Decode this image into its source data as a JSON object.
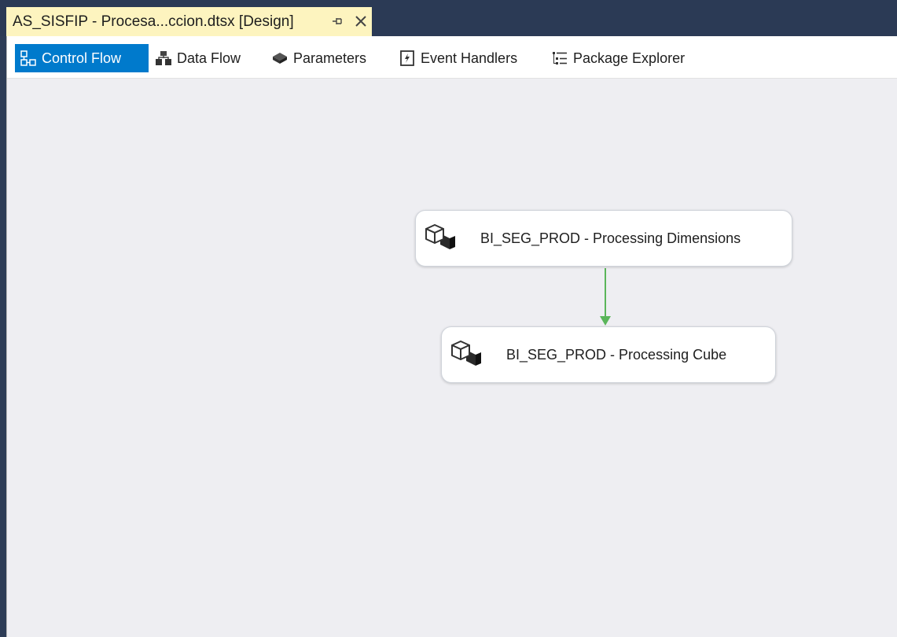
{
  "document_tab": {
    "title": "AS_SISFIP - Procesa...ccion.dtsx [Design]",
    "pin_icon": "pin-icon",
    "close_icon": "close-icon"
  },
  "designer_tabs": [
    {
      "label": "Control Flow",
      "icon": "control-flow-icon",
      "active": true
    },
    {
      "label": "Data Flow",
      "icon": "data-flow-icon",
      "active": false
    },
    {
      "label": "Parameters",
      "icon": "parameters-icon",
      "active": false
    },
    {
      "label": "Event Handlers",
      "icon": "event-handlers-icon",
      "active": false
    },
    {
      "label": "Package Explorer",
      "icon": "package-explorer-icon",
      "active": false
    }
  ],
  "tasks": [
    {
      "label": "BI_SEG_PROD - Processing Dimensions",
      "icon": "analysis-services-processing-task-icon"
    },
    {
      "label": "BI_SEG_PROD - Processing Cube",
      "icon": "analysis-services-processing-task-icon"
    }
  ],
  "precedence_constraint": {
    "from": 0,
    "to": 1,
    "status": "success",
    "color": "#5ab55a"
  },
  "colors": {
    "tab_active_bg": "#007acc",
    "document_tab_bg": "#fdf4bf",
    "window_chrome": "#2b3a55",
    "canvas_bg": "#eeeef2"
  }
}
